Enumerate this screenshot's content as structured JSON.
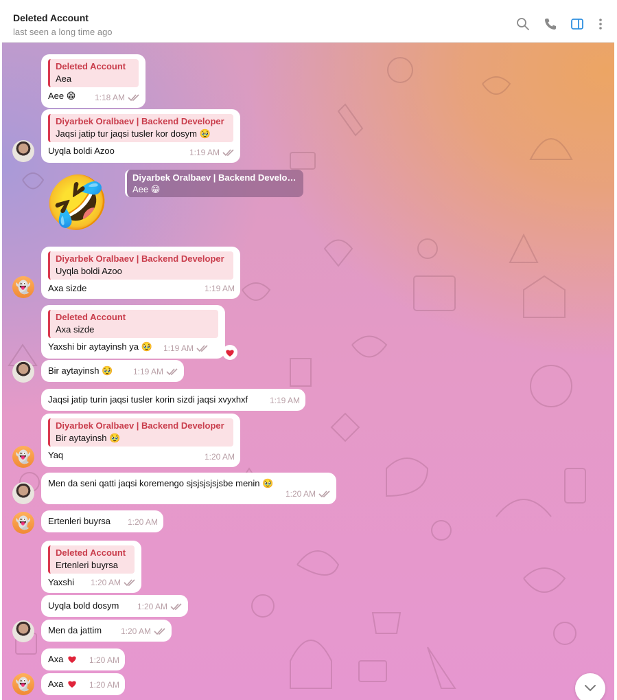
{
  "header": {
    "title": "Deleted Account",
    "status": "last seen a long time ago"
  },
  "messages": [
    {
      "quote_name": "Deleted Account",
      "quote_text": "Aea",
      "text": "Aee 😁",
      "time": "1:18 AM",
      "checks": true
    },
    {
      "quote_name": "Diyarbek Oralbaev | Backend Developer",
      "quote_text": "Jaqsi jatip tur jaqsi tusler kor dosym 🥹",
      "text": "Uyqla boldi Azoo",
      "time": "1:19 AM",
      "checks": true
    },
    {
      "sticker": "🤣",
      "reply_name": "Diyarbek Oralbaev | Backend Develo…",
      "reply_text": "Aee 😁"
    },
    {
      "quote_name": "Diyarbek Oralbaev | Backend Developer",
      "quote_text": "Uyqla boldi Azoo",
      "text": "Axa sizde",
      "time": "1:19 AM",
      "checks": false
    },
    {
      "quote_name": "Deleted Account",
      "quote_text": "Axa sizde",
      "text": "Yaxshi bir aytayinsh ya 🥹",
      "time": "1:19 AM",
      "checks": true,
      "reaction": "heart"
    },
    {
      "text": "Bir aytayinsh 🥹",
      "time": "1:19 AM",
      "checks": true
    },
    {
      "text": "Jaqsi jatip turin jaqsi tusler korin sizdi jaqsi xvyxhxf",
      "time": "1:19 AM",
      "checks": false
    },
    {
      "quote_name": "Diyarbek Oralbaev | Backend Developer",
      "quote_text": "Bir aytayinsh 🥹",
      "text": "Yaq",
      "time": "1:20 AM",
      "checks": false
    },
    {
      "text": "Men da seni qatti jaqsi koremengo sjsjsjsjsjsbe menin 🥹",
      "time": "1:20 AM",
      "checks": true
    },
    {
      "text": "Ertenleri buyrsa",
      "time": "1:20 AM",
      "checks": false
    },
    {
      "quote_name": "Deleted Account",
      "quote_text": "Ertenleri buyrsa",
      "text": "Yaxshi",
      "time": "1:20 AM",
      "checks": true
    },
    {
      "text": "Uyqla bold dosym",
      "time": "1:20 AM",
      "checks": true
    },
    {
      "text": "Men da jattim",
      "time": "1:20 AM",
      "checks": true
    },
    {
      "text": "Axa",
      "time": "1:20 AM",
      "checks": false,
      "inline_heart": true
    },
    {
      "text": "Axa",
      "time": "1:20 AM",
      "checks": false,
      "inline_heart": true
    }
  ],
  "icons": {
    "search": "search-icon",
    "call": "phone-icon",
    "sidebar": "sidebar-toggle-icon",
    "more": "more-vertical-icon",
    "scroll": "chevron-down-icon"
  },
  "colors": {
    "accent": "#2f90e0",
    "quote": "#d9394f",
    "heart": "#e0243a"
  }
}
